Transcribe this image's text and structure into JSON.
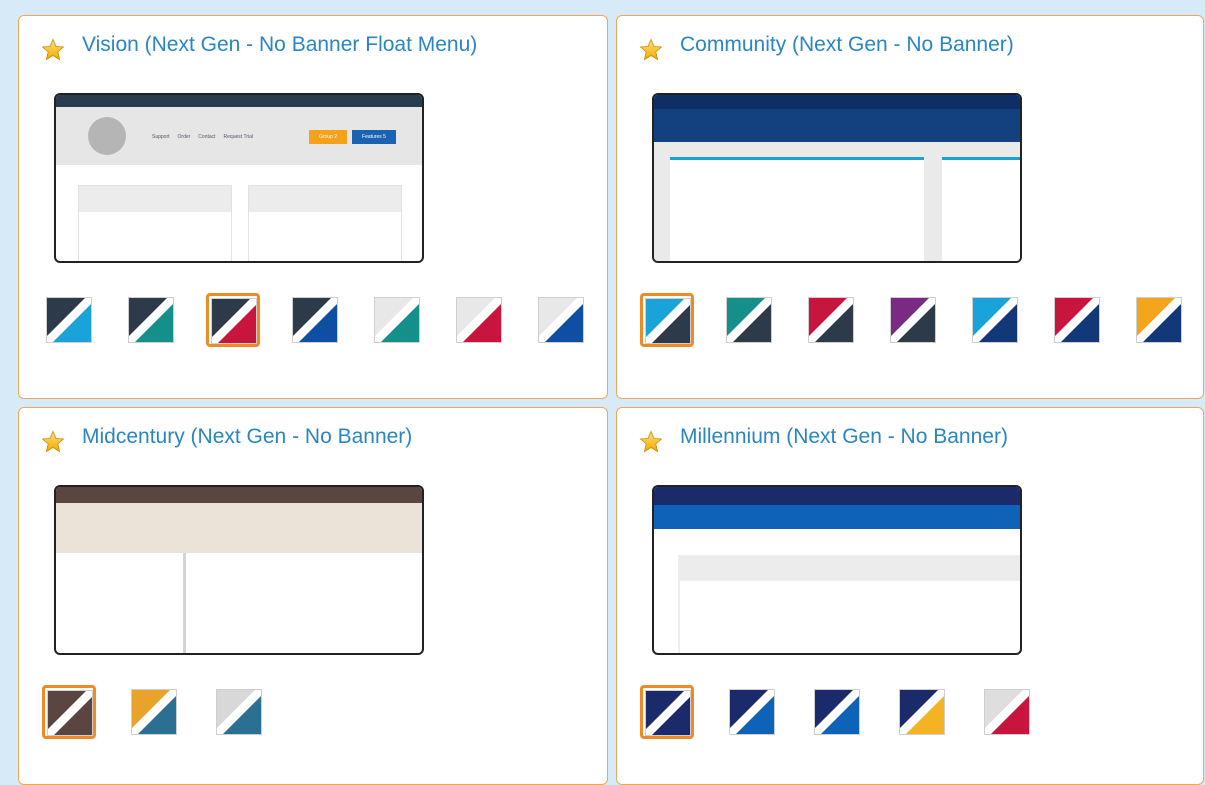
{
  "themes": [
    {
      "title": "Vision (Next Gen - No Banner Float Menu)",
      "preview": {
        "nav_items": [
          "Support",
          "Order",
          "Contact",
          "Request Trial"
        ],
        "buttons": [
          "Group 2",
          "Features 5"
        ]
      },
      "swatches": [
        {
          "name": "dark-blue",
          "a": "#2d3a4a",
          "b": "#1aa3d8",
          "selected": false
        },
        {
          "name": "dark-teal",
          "a": "#2d3a4a",
          "b": "#148f8a",
          "selected": false
        },
        {
          "name": "dark-red",
          "a": "#2d3a4a",
          "b": "#c8153e",
          "selected": true
        },
        {
          "name": "dark-navy",
          "a": "#2d3a4a",
          "b": "#0f4fa3",
          "selected": false
        },
        {
          "name": "light-teal",
          "a": "#e8e8e8",
          "b": "#148f8a",
          "selected": false
        },
        {
          "name": "light-red",
          "a": "#e8e8e8",
          "b": "#c8153e",
          "selected": false
        },
        {
          "name": "light-blue",
          "a": "#e8e8e8",
          "b": "#0f4fa3",
          "selected": false
        }
      ]
    },
    {
      "title": "Community (Next Gen - No Banner)",
      "swatches": [
        {
          "name": "blue-dark",
          "a": "#1aa3d8",
          "b": "#2d3a4a",
          "selected": true
        },
        {
          "name": "teal-dark",
          "a": "#148f8a",
          "b": "#2d3a4a",
          "selected": false
        },
        {
          "name": "red-dark",
          "a": "#c8153e",
          "b": "#2d3a4a",
          "selected": false
        },
        {
          "name": "purple-dark",
          "a": "#7a2a82",
          "b": "#2d3a4a",
          "selected": false
        },
        {
          "name": "blue-navy",
          "a": "#1aa3d8",
          "b": "#12387a",
          "selected": false
        },
        {
          "name": "red-navy",
          "a": "#c8153e",
          "b": "#12387a",
          "selected": false
        },
        {
          "name": "orange-navy",
          "a": "#f3a51c",
          "b": "#12387a",
          "selected": false
        }
      ]
    },
    {
      "title": "Midcentury (Next Gen - No Banner)",
      "swatches": [
        {
          "name": "brown",
          "a": "#5a4540",
          "b": "#5a4540",
          "selected": true
        },
        {
          "name": "gold-blue",
          "a": "#e9a22a",
          "b": "#2b6f93",
          "selected": false
        },
        {
          "name": "grey-blue",
          "a": "#d8d8d8",
          "b": "#2b6f93",
          "selected": false
        }
      ]
    },
    {
      "title": "Millennium (Next Gen - No Banner)",
      "swatches": [
        {
          "name": "navy",
          "a": "#1b2a6b",
          "b": "#1b2a6b",
          "selected": true
        },
        {
          "name": "navy-blue",
          "a": "#1b2a6b",
          "b": "#0e63b8",
          "selected": false
        },
        {
          "name": "navy-blue-2",
          "a": "#1b2a6b",
          "b": "#0e63b8",
          "selected": false
        },
        {
          "name": "navy-gold",
          "a": "#1b2a6b",
          "b": "#f3b322",
          "selected": false
        },
        {
          "name": "grey-red",
          "a": "#dedede",
          "b": "#c8153e",
          "selected": false
        }
      ]
    }
  ],
  "colors": {
    "title": "#2a86c2",
    "card_border": "#f0a65a",
    "selected_border": "#f08a24",
    "page_background": "#d6ebf7"
  }
}
